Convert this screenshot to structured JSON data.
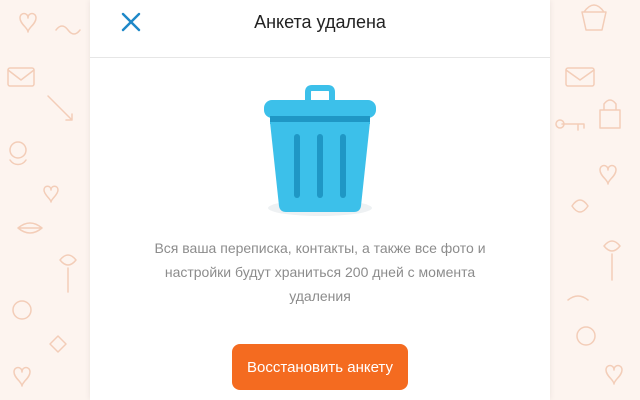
{
  "dialog": {
    "title": "Анкета удалена",
    "message": "Вся ваша переписка, контакты, а также все фото и настройки будут храниться 200 дней с момента удаления",
    "restore_label": "Восстановить анкету",
    "close_icon": "close-icon",
    "illustration_icon": "trash-can-icon"
  },
  "colors": {
    "background": "#fdf4ef",
    "pattern": "#f3cdb8",
    "card": "#ffffff",
    "accent": "#f46b20",
    "close": "#1e88c8",
    "trash": "#3cc0ea",
    "trash_dark": "#1f97c5",
    "text": "#222222",
    "muted_text": "#8c8c8c"
  }
}
